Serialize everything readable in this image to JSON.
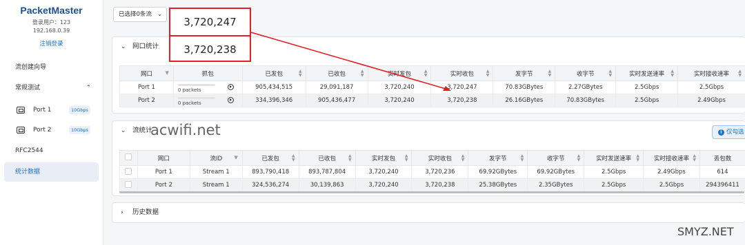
{
  "sidebar": {
    "brand": "PacketMaster",
    "user": "登录用户：123",
    "ip": "192.168.0.39",
    "logout": "注销登录",
    "nav_flow_wizard": "流创建向导",
    "nav_regular_test": "常规测试",
    "ports": [
      {
        "label": "Port 1",
        "speed": "10Gbps"
      },
      {
        "label": "Port 2",
        "speed": "10Gbps"
      }
    ],
    "nav_rfc": "RFC2544",
    "nav_stats": "统计数据"
  },
  "topbar": {
    "flow_select": "已选择0条流"
  },
  "callouts": [
    "3,720,247",
    "3,720,238"
  ],
  "port_stats": {
    "title": "网口统计",
    "columns": [
      "网口",
      "抓包",
      "已发包",
      "已收包",
      "实时发包",
      "实时收包",
      "发字节",
      "收字节",
      "实时发送速率",
      "实时接收速率"
    ],
    "rows": [
      {
        "port": "Port 1",
        "capture": "0 packets",
        "sent": "905,434,515",
        "received": "29,091,187",
        "rt_sent": "3,720,240",
        "rt_recv": "3,720,247",
        "tx_bytes": "70.83GBytes",
        "rx_bytes": "2.27GBytes",
        "tx_rate": "2.5Gbps",
        "rx_rate": "2.5Gbps"
      },
      {
        "port": "Port 2",
        "capture": "0 packets",
        "sent": "334,396,346",
        "received": "905,436,477",
        "rt_sent": "3,720,240",
        "rt_recv": "3,720,238",
        "tx_bytes": "26.16GBytes",
        "rx_bytes": "70.83GBytes",
        "tx_rate": "2.5Gbps",
        "rx_rate": "2.49Gbps"
      }
    ]
  },
  "flow_stats": {
    "title": "流统计",
    "only_button": "仅勾选",
    "columns": [
      "网口",
      "流ID",
      "已发包",
      "已收包",
      "实时发包",
      "实时收包",
      "发字节",
      "收字节",
      "实时发送速率",
      "实时接收速率",
      "丢包数"
    ],
    "rows": [
      {
        "port": "Port 1",
        "flow": "Stream 1",
        "sent": "893,790,418",
        "received": "893,787,804",
        "rt_sent": "3,720,240",
        "rt_recv": "3,720,236",
        "tx_bytes": "69.92GBytes",
        "rx_bytes": "69.92GBytes",
        "tx_rate": "2.5Gbps",
        "rx_rate": "2.49Gbps",
        "lost": "614"
      },
      {
        "port": "Port 2",
        "flow": "Stream 1",
        "sent": "324,536,274",
        "received": "30,139,863",
        "rt_sent": "3,720,240",
        "rt_recv": "3,720,238",
        "tx_bytes": "25.38GBytes",
        "rx_bytes": "2.35GBytes",
        "tx_rate": "2.5Gbps",
        "rx_rate": "2.5Gbps",
        "lost": "294396411"
      }
    ]
  },
  "history": {
    "title": "历史数据"
  },
  "watermarks": [
    "acwifi.net",
    "SMYZ.NET"
  ],
  "colors": {
    "accent": "#1a73c8",
    "highlight": "#e31e24",
    "brand": "#1d4f91"
  }
}
